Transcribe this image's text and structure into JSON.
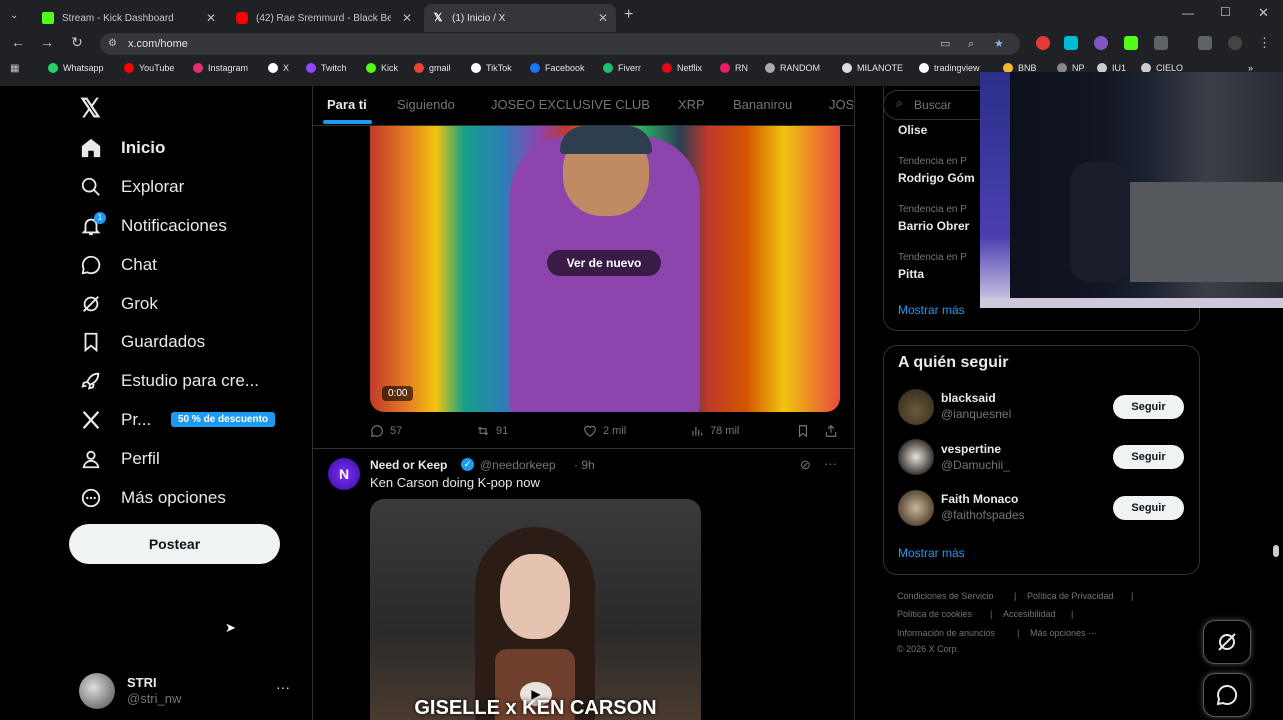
{
  "browser": {
    "tabs": [
      {
        "title": "Stream - Kick Dashboard",
        "color": "#53fc18"
      },
      {
        "title": "(42) Rae Sremmurd - Black Bea",
        "color": "#ff0000"
      },
      {
        "title": "(1) Inicio / X",
        "color": "#ffffff"
      }
    ],
    "url": "x.com/home",
    "bookmarks": [
      {
        "label": "Whatsapp",
        "color": "#25d366"
      },
      {
        "label": "YouTube",
        "color": "#ff0000"
      },
      {
        "label": "Instagram",
        "color": "#e1306c"
      },
      {
        "label": "X",
        "color": "#ffffff"
      },
      {
        "label": "Twitch",
        "color": "#9146ff"
      },
      {
        "label": "Kick",
        "color": "#53fc18"
      },
      {
        "label": "gmail",
        "color": "#ea4335"
      },
      {
        "label": "TikTok",
        "color": "#ffffff"
      },
      {
        "label": "Facebook",
        "color": "#1877f2"
      },
      {
        "label": "Fiverr",
        "color": "#1dbf73"
      },
      {
        "label": "Netflix",
        "color": "#e50914"
      },
      {
        "label": "RN",
        "color": "#e91e63"
      },
      {
        "label": "RANDOM",
        "color": "#aaaaaa"
      },
      {
        "label": "MILANOTE",
        "color": "#dddddd"
      },
      {
        "label": "tradingview",
        "color": "#ffffff"
      },
      {
        "label": "BNB",
        "color": "#f3ba2f"
      },
      {
        "label": "NP",
        "color": "#888888"
      },
      {
        "label": "IU1",
        "color": "#cccccc"
      },
      {
        "label": "CIELO",
        "color": "#cccccc"
      }
    ]
  },
  "nav": {
    "items": [
      {
        "label": "Inicio",
        "icon": "home-icon"
      },
      {
        "label": "Explorar",
        "icon": "search-icon"
      },
      {
        "label": "Notificaciones",
        "icon": "bell-icon"
      },
      {
        "label": "Chat",
        "icon": "chat-icon"
      },
      {
        "label": "Grok",
        "icon": "grok-icon"
      },
      {
        "label": "Guardados",
        "icon": "bookmark-icon"
      },
      {
        "label": "Estudio para cre...",
        "icon": "rocket-icon"
      },
      {
        "label": "Pr...",
        "icon": "x-logo-icon"
      },
      {
        "label": "Perfil",
        "icon": "person-icon"
      },
      {
        "label": "Más opciones",
        "icon": "more-circle-icon"
      }
    ],
    "notification_count": "1",
    "premium_badge": "50 % de descuento",
    "post_button": "Postear",
    "account": {
      "name": "STRI",
      "handle": "@stri_nw",
      "more": "···"
    }
  },
  "feed": {
    "tabs": [
      "Para ti",
      "Siguiendo",
      "JOSEO EXCLUSIVE CLUB",
      "XRP",
      "Bananirou",
      "JOS"
    ],
    "video": {
      "replay_label": "Ver de nuevo",
      "time": "0:00"
    },
    "actions": {
      "replies": "57",
      "reposts": "91",
      "likes": "2 mil",
      "views": "78 mil"
    },
    "tweet": {
      "name": "Need or Keep",
      "handle": "@needorkeep",
      "time": "· 9h",
      "text": "Ken Carson doing K-pop now",
      "media_caption": "GISELLE x KEN CARSON"
    }
  },
  "sidebar": {
    "search_placeholder": "Buscar",
    "trends": [
      {
        "category": "",
        "name": "Olise"
      },
      {
        "category": "Tendencia en P",
        "name": "Rodrigo Góm"
      },
      {
        "category": "Tendencia en P",
        "name": "Barrio Obrer"
      },
      {
        "category": "Tendencia en P",
        "name": "Pitta"
      }
    ],
    "show_more_trends": "Mostrar más",
    "who_to_follow": {
      "title": "A quién seguir",
      "users": [
        {
          "name": "blacksaid",
          "handle": "@ianquesnel",
          "button": "Seguir"
        },
        {
          "name": "vespertine",
          "handle": "@Damuchii_",
          "button": "Seguir"
        },
        {
          "name": "Faith Monaco",
          "handle": "@faithofspades",
          "button": "Seguir"
        }
      ],
      "show_more": "Mostrar más"
    },
    "footer": {
      "links": [
        "Condiciones de Servicio",
        "Política de Privacidad",
        "Política de cookies",
        "Accesibilidad",
        "Información de anuncios",
        "Más opciones ···"
      ],
      "copyright": "© 2026 X Corp."
    }
  }
}
